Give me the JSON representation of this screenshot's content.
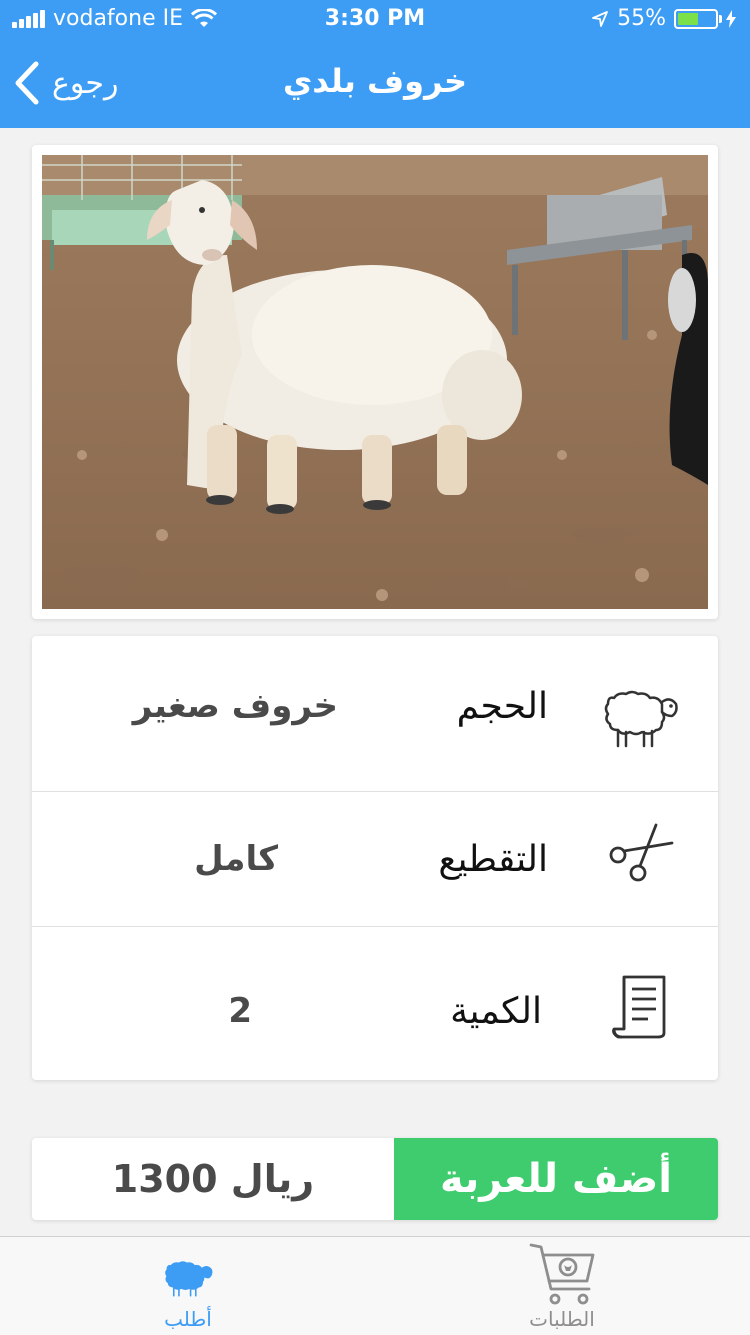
{
  "status_bar": {
    "carrier": "vodafone IE",
    "time": "3:30 PM",
    "battery": "55%",
    "battery_level": 0.55
  },
  "nav": {
    "back_label": "رجوع",
    "title": "خروف بلدي"
  },
  "details": [
    {
      "icon": "sheep-icon",
      "label": "الحجم",
      "value": "خروف صغير"
    },
    {
      "icon": "scissors-icon",
      "label": "التقطيع",
      "value": "كامل"
    },
    {
      "icon": "document-icon",
      "label": "الكمية",
      "value": "2"
    }
  ],
  "cart": {
    "add_label": "أضف للعربة",
    "price": "1300 ريال"
  },
  "tabs": [
    {
      "label": "أطلب",
      "icon": "sheep-icon",
      "active": true
    },
    {
      "label": "الطلبات",
      "icon": "cart-icon",
      "active": false
    }
  ],
  "colors": {
    "header": "#3d9df4",
    "add_button": "#3ecc6f",
    "active_tab": "#3d9df4",
    "inactive_tab": "#8e8e8e"
  }
}
